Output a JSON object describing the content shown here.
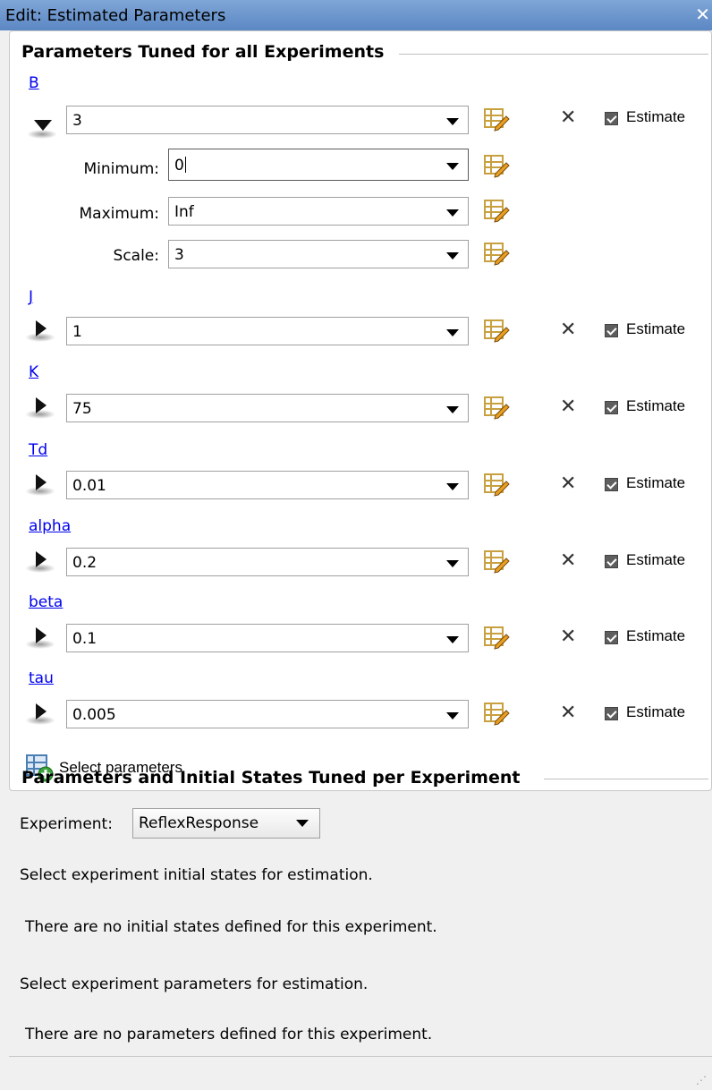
{
  "window": {
    "title": "Edit: Estimated Parameters",
    "close_glyph": "✕"
  },
  "tuned_all": {
    "heading": "Parameters Tuned for all Experiments",
    "estimate_label": "Estimate",
    "params": [
      {
        "name": "B",
        "value": "3",
        "expanded": true,
        "estimate": true,
        "fields": {
          "minimum_label": "Minimum:",
          "minimum": "0",
          "maximum_label": "Maximum:",
          "maximum": "Inf",
          "scale_label": "Scale:",
          "scale": "3"
        }
      },
      {
        "name": "J",
        "value": "1",
        "expanded": false,
        "estimate": true
      },
      {
        "name": "K",
        "value": "75",
        "expanded": false,
        "estimate": true
      },
      {
        "name": "Td",
        "value": "0.01",
        "expanded": false,
        "estimate": true
      },
      {
        "name": "alpha",
        "value": "0.2",
        "expanded": false,
        "estimate": true
      },
      {
        "name": "beta",
        "value": "0.1",
        "expanded": false,
        "estimate": true
      },
      {
        "name": "tau",
        "value": "0.005",
        "expanded": false,
        "estimate": true
      }
    ],
    "select_parameters_label": "Select parameters"
  },
  "per_experiment": {
    "heading": "Parameters and Initial States Tuned per Experiment",
    "experiment_label": "Experiment:",
    "experiment_value": "ReflexResponse",
    "states_prompt": "Select experiment initial states for estimation.",
    "states_message": "There are no initial states defined for this experiment.",
    "params_prompt": "Select experiment parameters for estimation.",
    "params_message": "There are no parameters defined for this experiment."
  },
  "icons": {
    "table_edit": "table-edit-icon",
    "remove": "remove-x-icon",
    "select_parameters": "add-table-icon"
  }
}
